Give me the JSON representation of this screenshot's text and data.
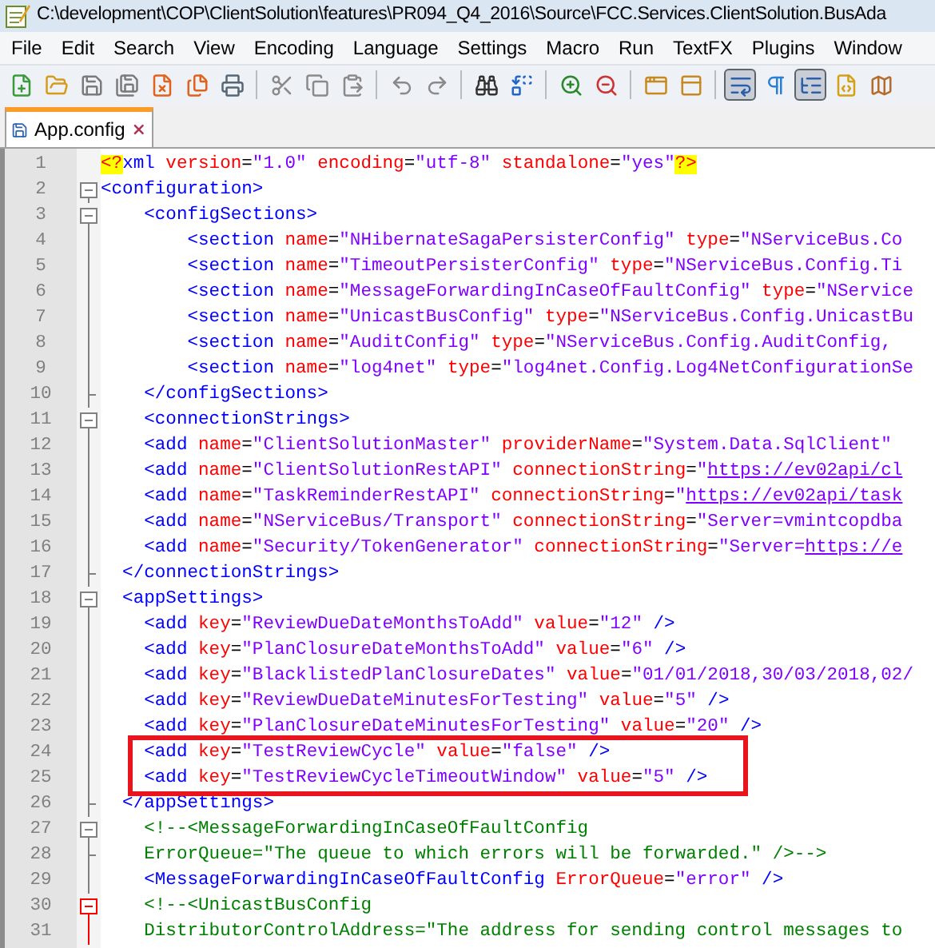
{
  "window": {
    "title": "C:\\development\\COP\\ClientSolution\\features\\PR094_Q4_2016\\Source\\FCC.Services.ClientSolution.BusAda"
  },
  "menu": [
    "File",
    "Edit",
    "Search",
    "View",
    "Encoding",
    "Language",
    "Settings",
    "Macro",
    "Run",
    "TextFX",
    "Plugins",
    "Window"
  ],
  "toolbar": [
    {
      "kind": "new",
      "pressed": false
    },
    {
      "kind": "open",
      "pressed": false
    },
    {
      "kind": "save",
      "pressed": false
    },
    {
      "kind": "save-all",
      "pressed": false
    },
    {
      "kind": "close",
      "pressed": false
    },
    {
      "kind": "close-all",
      "pressed": false
    },
    {
      "kind": "print",
      "pressed": false
    },
    {
      "kind": "separator"
    },
    {
      "kind": "cut",
      "pressed": false
    },
    {
      "kind": "copy",
      "pressed": false
    },
    {
      "kind": "paste",
      "pressed": false
    },
    {
      "kind": "separator"
    },
    {
      "kind": "undo",
      "pressed": false
    },
    {
      "kind": "redo",
      "pressed": false
    },
    {
      "kind": "separator"
    },
    {
      "kind": "find",
      "pressed": false
    },
    {
      "kind": "replace",
      "pressed": false
    },
    {
      "kind": "separator"
    },
    {
      "kind": "zoom-in",
      "pressed": false
    },
    {
      "kind": "zoom-out",
      "pressed": false
    },
    {
      "kind": "separator"
    },
    {
      "kind": "sync-vertical",
      "pressed": false
    },
    {
      "kind": "sync-horizontal",
      "pressed": false
    },
    {
      "kind": "separator"
    },
    {
      "kind": "word-wrap",
      "pressed": true
    },
    {
      "kind": "all-characters",
      "pressed": false
    },
    {
      "kind": "indent-guide",
      "pressed": true
    },
    {
      "kind": "language",
      "pressed": false
    },
    {
      "kind": "document-map",
      "pressed": false
    }
  ],
  "tabs": [
    {
      "label": "App.config",
      "selected": true
    }
  ],
  "lines": [
    {
      "number": "1",
      "kind": "top",
      "boxed": false,
      "tokens": [
        {
          "kind": "pi",
          "text": "<?"
        },
        {
          "kind": "tag",
          "text": "xml"
        },
        {
          "kind": "attr",
          "text": " version"
        },
        {
          "kind": "plain",
          "text": "="
        },
        {
          "kind": "value",
          "text": "\"1.0\""
        },
        {
          "kind": "attr",
          "text": " encoding"
        },
        {
          "kind": "plain",
          "text": "="
        },
        {
          "kind": "value",
          "text": "\"utf-8\""
        },
        {
          "kind": "attr",
          "text": " standalone"
        },
        {
          "kind": "plain",
          "text": "="
        },
        {
          "kind": "value",
          "text": "\"yes\""
        },
        {
          "kind": "pi",
          "text": "?>"
        }
      ]
    },
    {
      "number": "2",
      "kind": "fold-start",
      "fold_active": false,
      "boxed": false,
      "tokens": [
        {
          "kind": "tag",
          "text": "<configuration>"
        }
      ]
    },
    {
      "number": "3",
      "kind": "fold-start",
      "fold_active": false,
      "boxed": false,
      "tokens": [
        {
          "kind": "tag",
          "text": "    <configSections>"
        }
      ]
    },
    {
      "number": "4",
      "kind": "inside",
      "fold_active": false,
      "boxed": false,
      "tokens": [
        {
          "kind": "tag",
          "text": "        <section"
        },
        {
          "kind": "attr",
          "text": " name"
        },
        {
          "kind": "plain",
          "text": "="
        },
        {
          "kind": "value",
          "text": "\"NHibernateSagaPersisterConfig\""
        },
        {
          "kind": "attr",
          "text": " type"
        },
        {
          "kind": "plain",
          "text": "="
        },
        {
          "kind": "value",
          "text": "\"NServiceBus.Co"
        }
      ]
    },
    {
      "number": "5",
      "kind": "inside",
      "fold_active": false,
      "boxed": false,
      "tokens": [
        {
          "kind": "tag",
          "text": "        <section"
        },
        {
          "kind": "attr",
          "text": " name"
        },
        {
          "kind": "plain",
          "text": "="
        },
        {
          "kind": "value",
          "text": "\"TimeoutPersisterConfig\""
        },
        {
          "kind": "attr",
          "text": " type"
        },
        {
          "kind": "plain",
          "text": "="
        },
        {
          "kind": "value",
          "text": "\"NServiceBus.Config.Ti"
        }
      ]
    },
    {
      "number": "6",
      "kind": "inside",
      "fold_active": false,
      "boxed": false,
      "tokens": [
        {
          "kind": "tag",
          "text": "        <section"
        },
        {
          "kind": "attr",
          "text": " name"
        },
        {
          "kind": "plain",
          "text": "="
        },
        {
          "kind": "value",
          "text": "\"MessageForwardingInCaseOfFaultConfig\""
        },
        {
          "kind": "attr",
          "text": " type"
        },
        {
          "kind": "plain",
          "text": "="
        },
        {
          "kind": "value",
          "text": "\"NService"
        }
      ]
    },
    {
      "number": "7",
      "kind": "inside",
      "fold_active": false,
      "boxed": false,
      "tokens": [
        {
          "kind": "tag",
          "text": "        <section"
        },
        {
          "kind": "attr",
          "text": " name"
        },
        {
          "kind": "plain",
          "text": "="
        },
        {
          "kind": "value",
          "text": "\"UnicastBusConfig\""
        },
        {
          "kind": "attr",
          "text": " type"
        },
        {
          "kind": "plain",
          "text": "="
        },
        {
          "kind": "value",
          "text": "\"NServiceBus.Config.UnicastBu"
        }
      ]
    },
    {
      "number": "8",
      "kind": "inside",
      "fold_active": false,
      "boxed": false,
      "tokens": [
        {
          "kind": "tag",
          "text": "        <section"
        },
        {
          "kind": "attr",
          "text": " name"
        },
        {
          "kind": "plain",
          "text": "="
        },
        {
          "kind": "value",
          "text": "\"AuditConfig\""
        },
        {
          "kind": "attr",
          "text": " type"
        },
        {
          "kind": "plain",
          "text": "="
        },
        {
          "kind": "value",
          "text": "\"NServiceBus.Config.AuditConfig,"
        }
      ]
    },
    {
      "number": "9",
      "kind": "inside",
      "fold_active": false,
      "boxed": false,
      "tokens": [
        {
          "kind": "tag",
          "text": "        <section"
        },
        {
          "kind": "attr",
          "text": " name"
        },
        {
          "kind": "plain",
          "text": "="
        },
        {
          "kind": "value",
          "text": "\"log4net\""
        },
        {
          "kind": "attr",
          "text": " type"
        },
        {
          "kind": "plain",
          "text": "="
        },
        {
          "kind": "value",
          "text": "\"log4net.Config.Log4NetConfigurationSe"
        }
      ]
    },
    {
      "number": "10",
      "kind": "fold-end",
      "fold_active": false,
      "boxed": false,
      "tokens": [
        {
          "kind": "tag",
          "text": "    </configSections>"
        }
      ]
    },
    {
      "number": "11",
      "kind": "fold-start",
      "fold_active": false,
      "boxed": false,
      "tokens": [
        {
          "kind": "tag",
          "text": "    <connectionStrings>"
        }
      ]
    },
    {
      "number": "12",
      "kind": "inside",
      "fold_active": false,
      "boxed": false,
      "tokens": [
        {
          "kind": "tag",
          "text": "    <add"
        },
        {
          "kind": "attr",
          "text": " name"
        },
        {
          "kind": "plain",
          "text": "="
        },
        {
          "kind": "value",
          "text": "\"ClientSolutionMaster\""
        },
        {
          "kind": "attr",
          "text": " providerName"
        },
        {
          "kind": "plain",
          "text": "="
        },
        {
          "kind": "value",
          "text": "\"System.Data.SqlClient\""
        }
      ]
    },
    {
      "number": "13",
      "kind": "inside",
      "fold_active": false,
      "boxed": false,
      "tokens": [
        {
          "kind": "tag",
          "text": "    <add"
        },
        {
          "kind": "attr",
          "text": " name"
        },
        {
          "kind": "plain",
          "text": "="
        },
        {
          "kind": "value",
          "text": "\"ClientSolutionRestAPI\""
        },
        {
          "kind": "attr",
          "text": " connectionString"
        },
        {
          "kind": "plain",
          "text": "="
        },
        {
          "kind": "value",
          "text": "\""
        },
        {
          "kind": "link",
          "text": "https://ev02api/cl"
        }
      ]
    },
    {
      "number": "14",
      "kind": "inside",
      "fold_active": false,
      "boxed": false,
      "tokens": [
        {
          "kind": "tag",
          "text": "    <add"
        },
        {
          "kind": "attr",
          "text": " name"
        },
        {
          "kind": "plain",
          "text": "="
        },
        {
          "kind": "value",
          "text": "\"TaskReminderRestAPI\""
        },
        {
          "kind": "attr",
          "text": " connectionString"
        },
        {
          "kind": "plain",
          "text": "="
        },
        {
          "kind": "value",
          "text": "\""
        },
        {
          "kind": "link",
          "text": "https://ev02api/task"
        }
      ]
    },
    {
      "number": "15",
      "kind": "inside",
      "fold_active": false,
      "boxed": false,
      "tokens": [
        {
          "kind": "tag",
          "text": "    <add"
        },
        {
          "kind": "attr",
          "text": " name"
        },
        {
          "kind": "plain",
          "text": "="
        },
        {
          "kind": "value",
          "text": "\"NServiceBus/Transport\""
        },
        {
          "kind": "attr",
          "text": " connectionString"
        },
        {
          "kind": "plain",
          "text": "="
        },
        {
          "kind": "value",
          "text": "\"Server=vmintcopdba"
        }
      ]
    },
    {
      "number": "16",
      "kind": "inside",
      "fold_active": false,
      "boxed": false,
      "tokens": [
        {
          "kind": "tag",
          "text": "    <add"
        },
        {
          "kind": "attr",
          "text": " name"
        },
        {
          "kind": "plain",
          "text": "="
        },
        {
          "kind": "value",
          "text": "\"Security/TokenGenerator\""
        },
        {
          "kind": "attr",
          "text": " connectionString"
        },
        {
          "kind": "plain",
          "text": "="
        },
        {
          "kind": "value",
          "text": "\"Server="
        },
        {
          "kind": "link",
          "text": "https://e"
        }
      ]
    },
    {
      "number": "17",
      "kind": "fold-end",
      "fold_active": false,
      "boxed": false,
      "tokens": [
        {
          "kind": "tag",
          "text": "  </connectionStrings>"
        }
      ]
    },
    {
      "number": "18",
      "kind": "fold-start",
      "fold_active": false,
      "boxed": false,
      "tokens": [
        {
          "kind": "tag",
          "text": "  <appSettings>"
        }
      ]
    },
    {
      "number": "19",
      "kind": "inside",
      "fold_active": false,
      "boxed": false,
      "tokens": [
        {
          "kind": "tag",
          "text": "    <add"
        },
        {
          "kind": "attr",
          "text": " key"
        },
        {
          "kind": "plain",
          "text": "="
        },
        {
          "kind": "value",
          "text": "\"ReviewDueDateMonthsToAdd\""
        },
        {
          "kind": "attr",
          "text": " value"
        },
        {
          "kind": "plain",
          "text": "="
        },
        {
          "kind": "value",
          "text": "\"12\""
        },
        {
          "kind": "tag",
          "text": " />"
        }
      ]
    },
    {
      "number": "20",
      "kind": "inside",
      "fold_active": false,
      "boxed": false,
      "tokens": [
        {
          "kind": "tag",
          "text": "    <add"
        },
        {
          "kind": "attr",
          "text": " key"
        },
        {
          "kind": "plain",
          "text": "="
        },
        {
          "kind": "value",
          "text": "\"PlanClosureDateMonthsToAdd\""
        },
        {
          "kind": "attr",
          "text": " value"
        },
        {
          "kind": "plain",
          "text": "="
        },
        {
          "kind": "value",
          "text": "\"6\""
        },
        {
          "kind": "tag",
          "text": " />"
        }
      ]
    },
    {
      "number": "21",
      "kind": "inside",
      "fold_active": false,
      "boxed": false,
      "tokens": [
        {
          "kind": "tag",
          "text": "    <add"
        },
        {
          "kind": "attr",
          "text": " key"
        },
        {
          "kind": "plain",
          "text": "="
        },
        {
          "kind": "value",
          "text": "\"BlacklistedPlanClosureDates\""
        },
        {
          "kind": "attr",
          "text": " value"
        },
        {
          "kind": "plain",
          "text": "="
        },
        {
          "kind": "value",
          "text": "\"01/01/2018,30/03/2018,02/"
        }
      ]
    },
    {
      "number": "22",
      "kind": "inside",
      "fold_active": false,
      "boxed": false,
      "tokens": [
        {
          "kind": "tag",
          "text": "    <add"
        },
        {
          "kind": "attr",
          "text": " key"
        },
        {
          "kind": "plain",
          "text": "="
        },
        {
          "kind": "value",
          "text": "\"ReviewDueDateMinutesForTesting\""
        },
        {
          "kind": "attr",
          "text": " value"
        },
        {
          "kind": "plain",
          "text": "="
        },
        {
          "kind": "value",
          "text": "\"5\""
        },
        {
          "kind": "tag",
          "text": " />"
        }
      ]
    },
    {
      "number": "23",
      "kind": "inside",
      "fold_active": false,
      "boxed": false,
      "tokens": [
        {
          "kind": "tag",
          "text": "    <add"
        },
        {
          "kind": "attr",
          "text": " key"
        },
        {
          "kind": "plain",
          "text": "="
        },
        {
          "kind": "value",
          "text": "\"PlanClosureDateMinutesForTesting\""
        },
        {
          "kind": "attr",
          "text": " value"
        },
        {
          "kind": "plain",
          "text": "="
        },
        {
          "kind": "value",
          "text": "\"20\""
        },
        {
          "kind": "tag",
          "text": " />"
        }
      ]
    },
    {
      "number": "24",
      "kind": "inside",
      "fold_active": false,
      "boxed": true,
      "tokens": [
        {
          "kind": "tag",
          "text": "    <add"
        },
        {
          "kind": "attr",
          "text": " key"
        },
        {
          "kind": "plain",
          "text": "="
        },
        {
          "kind": "value",
          "text": "\"TestReviewCycle\""
        },
        {
          "kind": "attr",
          "text": " value"
        },
        {
          "kind": "plain",
          "text": "="
        },
        {
          "kind": "value",
          "text": "\"false\""
        },
        {
          "kind": "tag",
          "text": " />"
        }
      ]
    },
    {
      "number": "25",
      "kind": "inside",
      "fold_active": false,
      "boxed": true,
      "tokens": [
        {
          "kind": "tag",
          "text": "    <add"
        },
        {
          "kind": "attr",
          "text": " key"
        },
        {
          "kind": "plain",
          "text": "="
        },
        {
          "kind": "value",
          "text": "\"TestReviewCycleTimeoutWindow\""
        },
        {
          "kind": "attr",
          "text": " value"
        },
        {
          "kind": "plain",
          "text": "="
        },
        {
          "kind": "value",
          "text": "\"5\""
        },
        {
          "kind": "tag",
          "text": " />"
        }
      ]
    },
    {
      "number": "26",
      "kind": "fold-end",
      "fold_active": false,
      "boxed": false,
      "tokens": [
        {
          "kind": "tag",
          "text": "  </appSettings>"
        }
      ]
    },
    {
      "number": "27",
      "kind": "fold-start",
      "fold_active": false,
      "boxed": false,
      "tokens": [
        {
          "kind": "comment",
          "text": "    <!--<MessageForwardingInCaseOfFaultConfig"
        }
      ]
    },
    {
      "number": "28",
      "kind": "fold-end",
      "fold_active": false,
      "boxed": false,
      "tokens": [
        {
          "kind": "comment",
          "text": "    ErrorQueue=\"The queue to which errors will be forwarded.\" />-->"
        }
      ]
    },
    {
      "number": "29",
      "kind": "inside",
      "fold_active": false,
      "boxed": false,
      "tokens": [
        {
          "kind": "tag",
          "text": "    <MessageForwardingInCaseOfFaultConfig"
        },
        {
          "kind": "attr",
          "text": " ErrorQueue"
        },
        {
          "kind": "plain",
          "text": "="
        },
        {
          "kind": "value",
          "text": "\"error\""
        },
        {
          "kind": "tag",
          "text": " />"
        }
      ]
    },
    {
      "number": "30",
      "kind": "fold-start",
      "fold_active": true,
      "boxed": false,
      "tokens": [
        {
          "kind": "comment",
          "text": "    <!--<UnicastBusConfig"
        }
      ]
    },
    {
      "number": "31",
      "kind": "inside",
      "fold_active": true,
      "boxed": false,
      "tokens": [
        {
          "kind": "comment",
          "text": "    DistributorControlAddress=\"The address for sending control messages to"
        }
      ]
    }
  ]
}
